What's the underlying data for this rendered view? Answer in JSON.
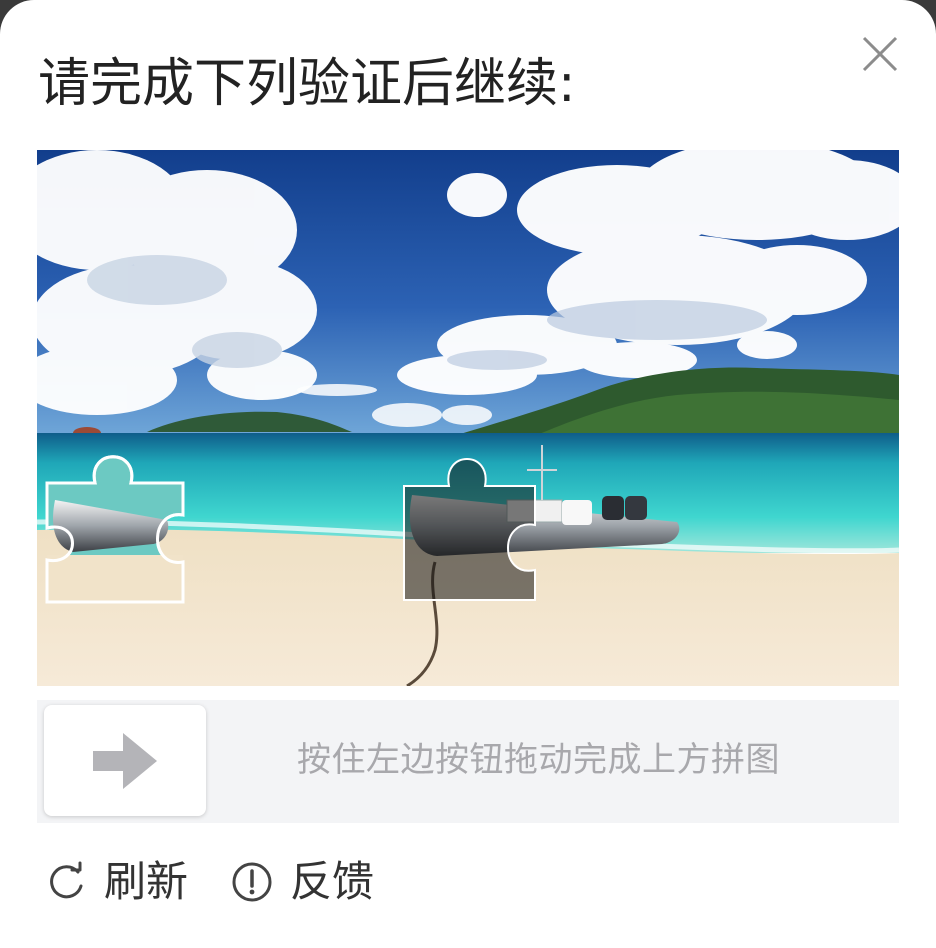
{
  "dialog": {
    "title": "请完成下列验证后继续:",
    "close_icon": "close-icon"
  },
  "captcha": {
    "image_description": "beach-with-boat-puzzle",
    "slider": {
      "handle_icon": "arrow-right-icon",
      "hint": "按住左边按钮拖动完成上方拼图"
    }
  },
  "footer": {
    "refresh": {
      "icon": "refresh-icon",
      "label": "刷新"
    },
    "feedback": {
      "icon": "info-circle-icon",
      "label": "反馈"
    }
  },
  "colors": {
    "sky": "#1c4fa0",
    "water": "#2ed0c8",
    "sand": "#f3e3c8",
    "slider_bg": "#f3f4f6",
    "hint_text": "#a8a8ac"
  }
}
